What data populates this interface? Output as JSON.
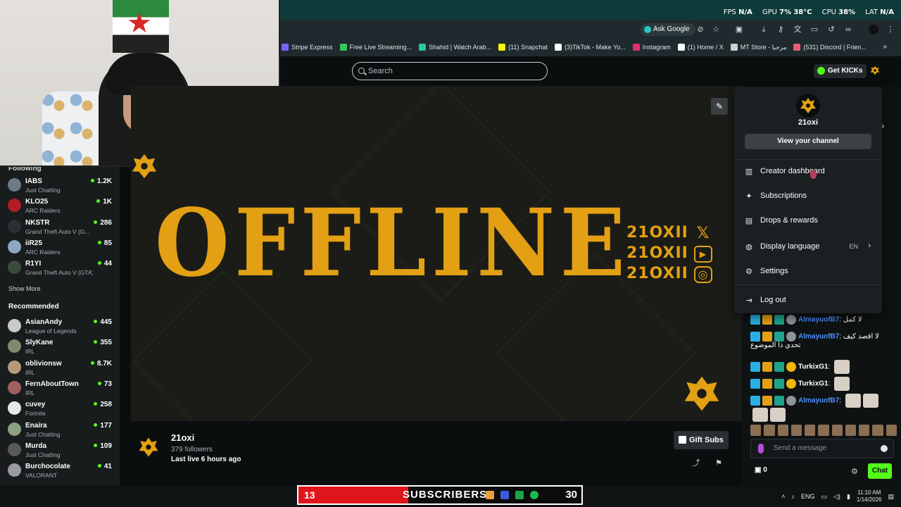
{
  "stats": {
    "fps_label": "FPS",
    "fps_value": "N/A",
    "gpu_label": "GPU",
    "gpu_value": "7%",
    "gpu_temp": "38°C",
    "cpu_label": "CPU",
    "cpu_value": "38%",
    "lat_label": "LAT",
    "lat_value": "N/A"
  },
  "toolbar": {
    "ask_google": "Ask Google"
  },
  "bookmarks": [
    {
      "label": "Stripe Express",
      "color": "#7b61ff"
    },
    {
      "label": "Free Live Streaming...",
      "color": "#34c759"
    },
    {
      "label": "Shahid | Watch Arab...",
      "color": "#2ac7a8"
    },
    {
      "label": "(11) Snapchat",
      "color": "#fffc00"
    },
    {
      "label": "(3)TikTok - Make Yo...",
      "color": "#ffffff"
    },
    {
      "label": "Instagram",
      "color": "#e1306c"
    },
    {
      "label": "(1) Home / X",
      "color": "#ffffff"
    },
    {
      "label": "MT Store - مرحبا",
      "color": "#cfcfcf"
    },
    {
      "label": "(531) Discord | Frien...",
      "color": "#e85d75"
    }
  ],
  "header": {
    "search_placeholder": "Search",
    "get_kicks": "Get KICKs"
  },
  "sidebar": {
    "following_label": "Following",
    "following": [
      {
        "name": "IABS",
        "category": "Just Chatting",
        "viewers": "1.2K",
        "color": "#6b7a86"
      },
      {
        "name": "KLO25",
        "category": "ARC Raiders",
        "viewers": "1K",
        "color": "#b01d24"
      },
      {
        "name": "NKSTR",
        "category": "Grand Theft Auto V (G...",
        "viewers": "286",
        "color": "#2a2f33"
      },
      {
        "name": "iiR25",
        "category": "ARC Raiders",
        "viewers": "85",
        "color": "#8fa7c4"
      },
      {
        "name": "R1YI",
        "category": "Grand Theft Auto V (GTA)",
        "viewers": "44",
        "color": "#3a4a3a"
      }
    ],
    "show_more": "Show More",
    "recommended_label": "Recommended",
    "recommended": [
      {
        "name": "AsianAndy",
        "category": "League of Legends",
        "viewers": "445",
        "color": "#c9c9c9"
      },
      {
        "name": "SlyKane",
        "category": "IRL",
        "viewers": "355",
        "color": "#7d8a70"
      },
      {
        "name": "oblivionsw",
        "category": "IRL",
        "viewers": "8.7K",
        "color": "#b89a7a"
      },
      {
        "name": "FernAboutTown",
        "category": "IRL",
        "viewers": "73",
        "color": "#a06060"
      },
      {
        "name": "cuvey",
        "category": "Fortnite",
        "viewers": "258",
        "color": "#e8e8e8"
      },
      {
        "name": "Enaira",
        "category": "Just Chatting",
        "viewers": "177",
        "color": "#8aa080"
      },
      {
        "name": "Murda",
        "category": "Just Chatting",
        "viewers": "109",
        "color": "#5a5a5a"
      },
      {
        "name": "Burchocolate",
        "category": "VALORANT",
        "viewers": "41",
        "color": "#9a9aa0"
      }
    ]
  },
  "video": {
    "offline_text": "OFFLINE",
    "socials": [
      {
        "handle": "21OXII",
        "icon": "x-icon"
      },
      {
        "handle": "21OXII",
        "icon": "youtube-icon"
      },
      {
        "handle": "21OXII",
        "icon": "instagram-icon"
      }
    ]
  },
  "channel": {
    "name": "21oxi",
    "followers": "379 followers",
    "last_live": "Last live 6 hours ago",
    "gift_subs": "Gift Subs"
  },
  "menu": {
    "username": "21oxi",
    "view_channel": "View your channel",
    "items": [
      {
        "label": "Creator dashboard",
        "icon": "chart-icon"
      },
      {
        "label": "Subscriptions",
        "icon": "sparkle-icon"
      },
      {
        "label": "Drops & rewards",
        "icon": "gift-icon"
      },
      {
        "label": "Display language",
        "icon": "globe-icon",
        "value": "EN"
      },
      {
        "label": "Settings",
        "icon": "gear-icon"
      },
      {
        "label": "Log out",
        "icon": "logout-icon"
      }
    ]
  },
  "chat": {
    "messages": [
      {
        "user": "AlmayuofB7",
        "color": "#4a90ff",
        "text": "لا كمل"
      },
      {
        "user": "AlmayuofB7",
        "color": "#4a90ff",
        "text": "لا اقصد كيف تحدي ذا الموضوع"
      },
      {
        "user": "TurkixG1",
        "color": "#ffffff",
        "text": ""
      },
      {
        "user": "TurkixG1",
        "color": "#ffffff",
        "text": ""
      },
      {
        "user": "AlmayuofB7",
        "color": "#4a90ff",
        "text": ""
      }
    ],
    "input_placeholder": "Send a message",
    "points": "0",
    "chat_button": "Chat"
  },
  "subscribers_bar": {
    "left": "13",
    "title": "SUBSCRIBERS",
    "right": "30"
  },
  "tray": {
    "language": "ENG",
    "time": "11:10 AM",
    "date": "1/14/2026"
  }
}
